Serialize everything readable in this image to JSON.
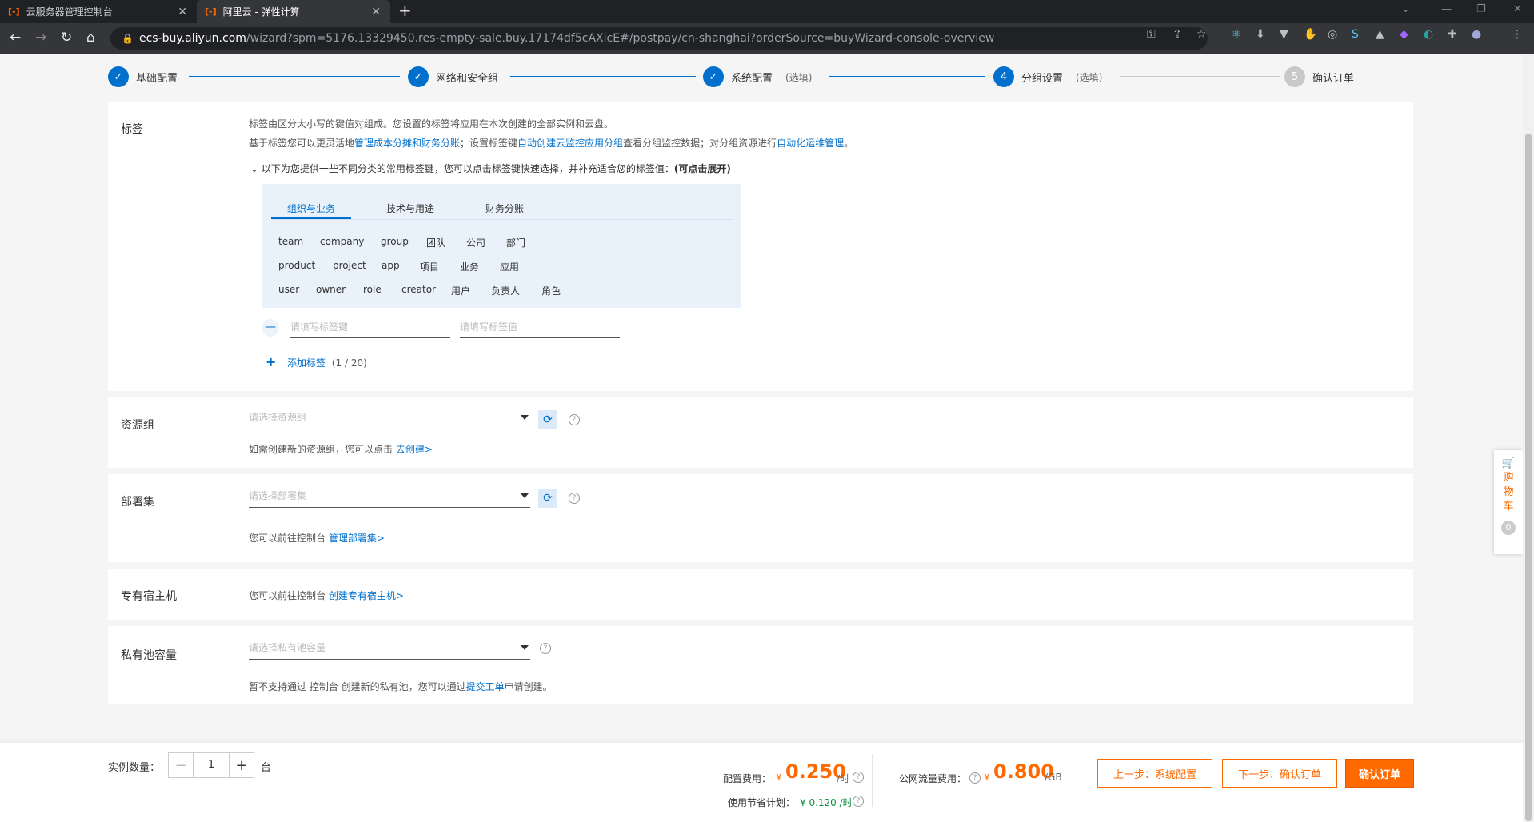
{
  "browser": {
    "tabs": [
      {
        "title": "云服务器管理控制台",
        "active": false
      },
      {
        "title": "阿里云 - 弹性计算",
        "active": true
      }
    ],
    "url_host": "ecs-buy.aliyun.com",
    "url_path": "/wizard?spm=5176.13329450.res-empty-sale.buy.17174df5cAXicE#/postpay/cn-shanghai?orderSource=buyWizard-console-overview"
  },
  "steps": [
    {
      "num": "✓",
      "label": "基础配置",
      "optional": "",
      "done": true
    },
    {
      "num": "✓",
      "label": "网络和安全组",
      "optional": "",
      "done": true
    },
    {
      "num": "✓",
      "label": "系统配置",
      "optional": "(选填)",
      "done": true
    },
    {
      "num": "4",
      "label": "分组设置",
      "optional": "(选填)",
      "done": true
    },
    {
      "num": "5",
      "label": "确认订单",
      "optional": "",
      "done": false
    }
  ],
  "tags": {
    "label": "标签",
    "desc1": "标签由区分大小写的键值对组成。您设置的标签将应用在本次创建的全部实例和云盘。",
    "desc2_a": "基于标签您可以更灵活地",
    "desc2_link1": "管理成本分摊和财务分账",
    "desc2_b": "；设置标签键",
    "desc2_link2": "自动创建云监控应用分组",
    "desc2_c": "查看分组监控数据；对分组资源进行",
    "desc2_link3": "自动化运维管理",
    "desc2_d": "。",
    "expand_text": "以下为您提供一些不同分类的常用标签键，您可以点击标签键快速选择，并补充适合您的标签值：",
    "expand_bold": "(可点击展开)",
    "categories": [
      "组织与业务",
      "技术与用途",
      "财务分账"
    ],
    "rows": [
      [
        "team",
        "company",
        "group",
        "团队",
        "公司",
        "部门"
      ],
      [
        "product",
        "project",
        "app",
        "项目",
        "业务",
        "应用"
      ],
      [
        "user",
        "owner",
        "role",
        "creator",
        "用户",
        "负责人",
        "角色"
      ]
    ],
    "key_placeholder": "请填写标签键",
    "value_placeholder": "请填写标签值",
    "add_label": "添加标签",
    "add_count": "(1 / 20)"
  },
  "resource_group": {
    "label": "资源组",
    "placeholder": "请选择资源组",
    "hint": "如需创建新的资源组，您可以点击",
    "hint_link": "去创建>"
  },
  "deployment_set": {
    "label": "部署集",
    "placeholder": "请选择部署集",
    "hint": "您可以前往控制台",
    "hint_link": "管理部署集>"
  },
  "dedicated_host": {
    "label": "专有宿主机",
    "hint": "您可以前往控制台",
    "hint_link": "创建专有宿主机>"
  },
  "private_pool": {
    "label": "私有池容量",
    "placeholder": "请选择私有池容量",
    "hint": "暂不支持通过 控制台 创建新的私有池，您可以通过",
    "hint_link": "提交工单",
    "hint_tail": "申请创建。"
  },
  "cart": {
    "label": "购物车",
    "count": "0"
  },
  "footer": {
    "qty_label": "实例数量：",
    "qty_value": "1",
    "qty_unit": "台",
    "config_fee_label": "配置费用：",
    "config_fee_currency": "¥",
    "config_fee_value": "0.250",
    "config_fee_unit": "/时",
    "saving_label": "使用节省计划：",
    "saving_value": "¥ 0.120 /时",
    "traffic_label": "公网流量费用：",
    "traffic_currency": "¥",
    "traffic_value": "0.800",
    "traffic_unit": "/GB",
    "prev_button": "上一步：系统配置",
    "next_button": "下一步：确认订单",
    "confirm_button": "确认订单"
  }
}
